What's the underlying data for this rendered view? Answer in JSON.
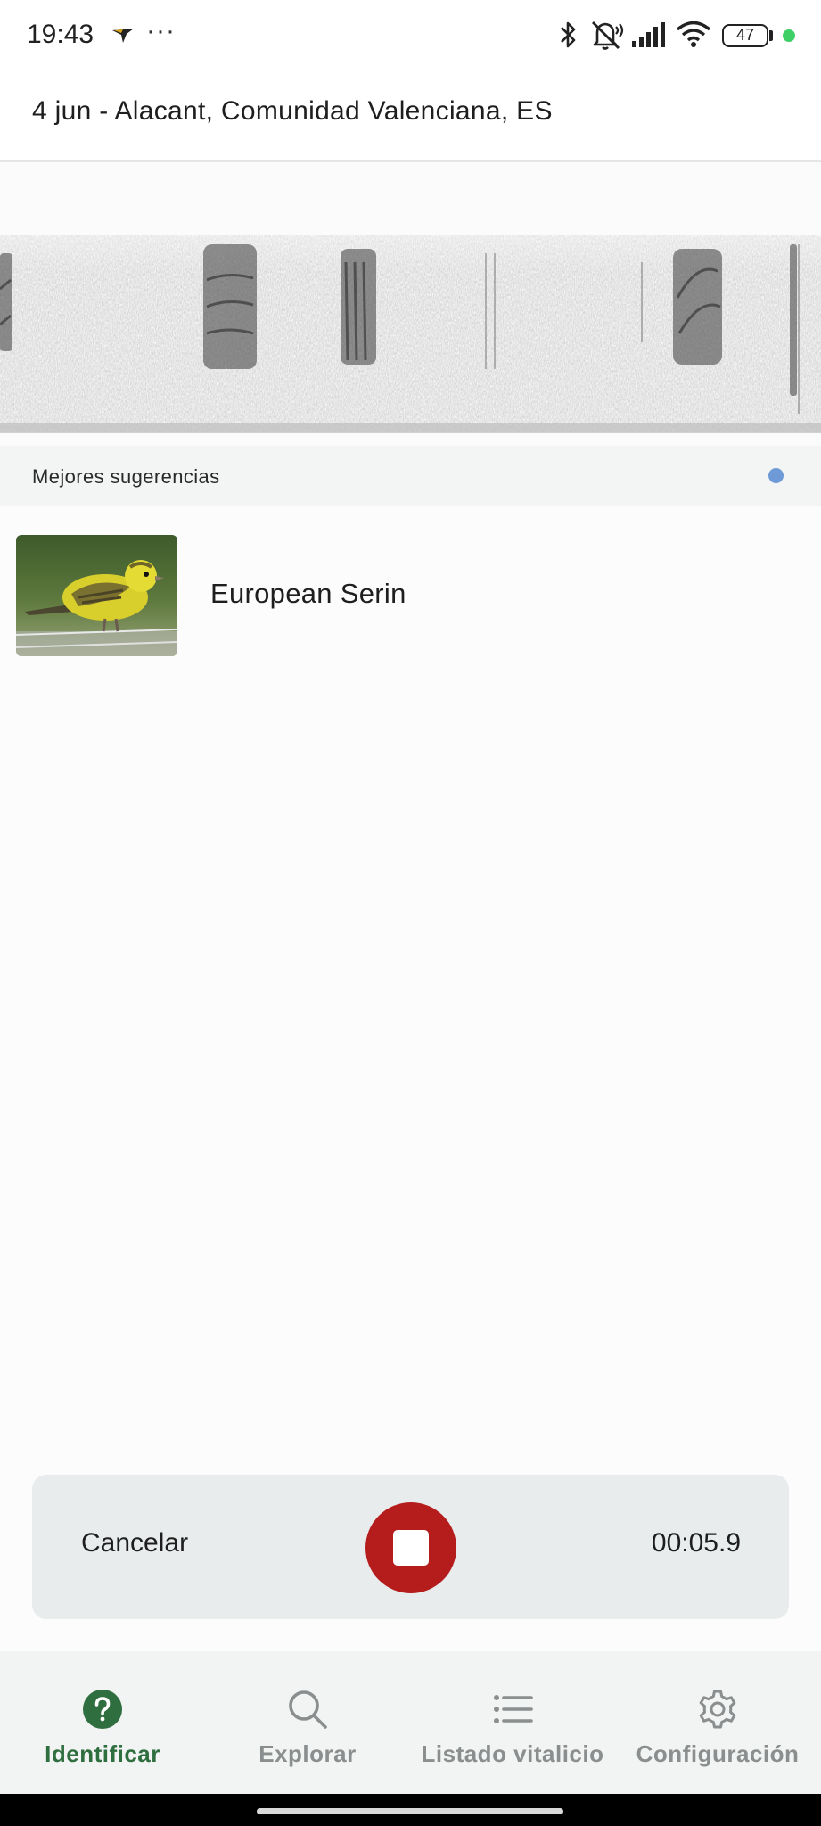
{
  "status_bar": {
    "time": "19:43",
    "more": "···",
    "battery": "47",
    "icons": [
      "bird-app-icon",
      "bluetooth-icon",
      "mute-icon",
      "signal-icon",
      "wifi-icon",
      "battery-icon"
    ]
  },
  "header": {
    "title": "4 jun - Alacant, Comunidad Valenciana, ES"
  },
  "suggestions": {
    "label": "Mejores sugerencias",
    "dot_color": "#6e9ad8",
    "items": [
      {
        "name": "European Serin",
        "image": "european-serin-photo"
      }
    ]
  },
  "recording": {
    "cancel_label": "Cancelar",
    "timer": "00:05.9",
    "stop_color": "#b51c1c"
  },
  "bottom_nav": {
    "items": [
      {
        "label": "Identificar",
        "icon": "help-circle-icon",
        "active": true
      },
      {
        "label": "Explorar",
        "icon": "search-icon",
        "active": false
      },
      {
        "label": "Listado vitalicio",
        "icon": "list-icon",
        "active": false
      },
      {
        "label": "Configuración",
        "icon": "gear-icon",
        "active": false
      }
    ],
    "active_color": "#2f6e3f"
  }
}
